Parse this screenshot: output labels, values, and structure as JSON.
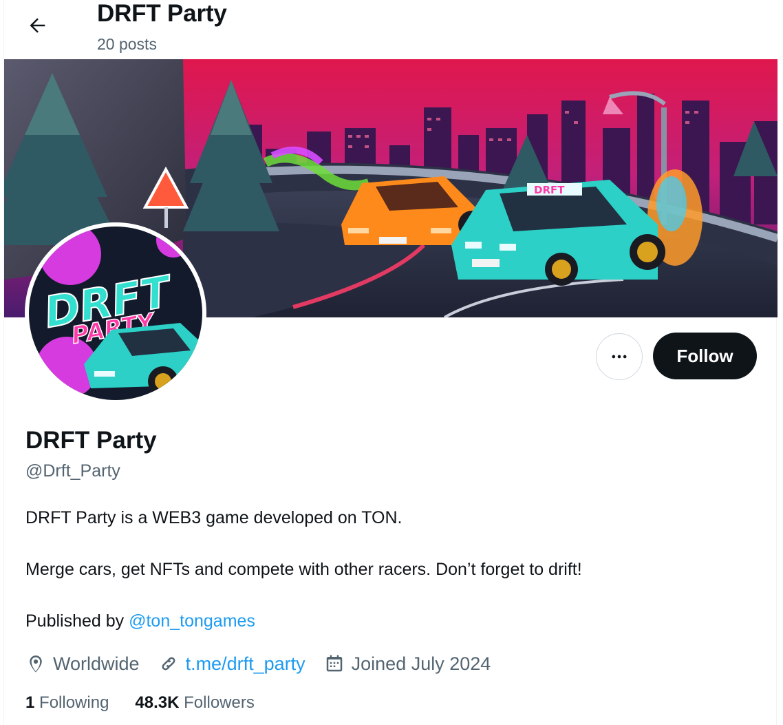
{
  "header": {
    "title": "DRFT Party",
    "posts_count": "20 posts"
  },
  "profile": {
    "name": "DRFT Party",
    "handle": "@Drft_Party",
    "bio_line1": "DRFT Party is a WEB3 game developed on TON.",
    "bio_line2": "Merge cars, get NFTs and compete with other racers. Don’t forget to drift!",
    "bio_line3_prefix": "Published by",
    "bio_line3_link": "@ton_tongames",
    "location": "Worldwide",
    "website": "t.me/drft_party",
    "joined": "Joined July 2024",
    "following_count": "1",
    "following_label": "Following",
    "followers_count": "48.3K",
    "followers_label": "Followers"
  },
  "actions": {
    "follow_label": "Follow",
    "more_icon": "more-horizontal-icon"
  },
  "avatar_text": {
    "logo_top": "DRFT",
    "logo_bottom": "PARTY"
  },
  "banner_text": {
    "car_hood": "DRFT"
  },
  "icons": {
    "back": "arrow-left-icon",
    "location": "location-pin-icon",
    "link": "link-icon",
    "calendar": "calendar-icon"
  },
  "colors": {
    "accent_link": "#1d9bf0",
    "follow_button_bg": "#0f1419",
    "secondary_text": "#536471",
    "banner_sky_top": "#e0174d",
    "banner_sky_bottom": "#5a1e7a"
  }
}
